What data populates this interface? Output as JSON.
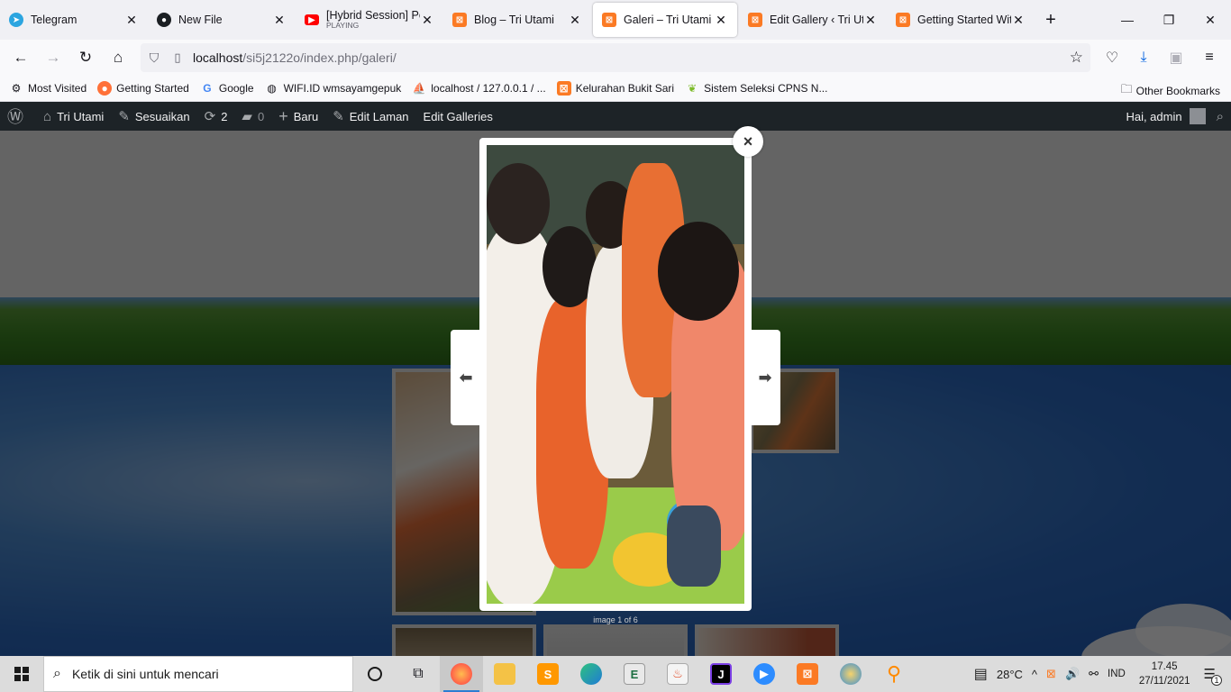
{
  "browser": {
    "tabs": [
      {
        "label": "Telegram",
        "icon": "telegram-icon",
        "sub": ""
      },
      {
        "label": "New File",
        "icon": "github-icon",
        "sub": ""
      },
      {
        "label": "[Hybrid Session] Per",
        "icon": "youtube-icon",
        "sub": "PLAYING"
      },
      {
        "label": "Blog – Tri Utami",
        "icon": "xampp-icon",
        "sub": ""
      },
      {
        "label": "Galeri – Tri Utami",
        "icon": "xampp-icon",
        "sub": ""
      },
      {
        "label": "Edit Gallery ‹ Tri Utar",
        "icon": "xampp-icon",
        "sub": ""
      },
      {
        "label": "Getting Started With",
        "icon": "xampp-icon",
        "sub": ""
      }
    ],
    "active_tab": 4,
    "url_host": "localhost",
    "url_path": "/si5j2122o/index.php/galeri/",
    "bookmarks": [
      {
        "label": "Most Visited",
        "icon": "gear-icon"
      },
      {
        "label": "Getting Started",
        "icon": "firefox-icon"
      },
      {
        "label": "Google",
        "icon": "google-icon"
      },
      {
        "label": "WIFI.ID wmsayamgepuk",
        "icon": "globe-icon"
      },
      {
        "label": "localhost / 127.0.0.1 / ...",
        "icon": "phpmyadmin-icon"
      },
      {
        "label": "Kelurahan Bukit Sari",
        "icon": "xampp-icon"
      },
      {
        "label": "Sistem Seleksi CPNS N...",
        "icon": "leaf-icon"
      }
    ],
    "other_bookmarks": "Other Bookmarks"
  },
  "wp_admin_bar": {
    "site_name": "Tri Utami",
    "customize": "Sesuaikan",
    "updates_count": "2",
    "comments_count": "0",
    "new_label": "Baru",
    "edit_page": "Edit Laman",
    "edit_galleries": "Edit Galleries",
    "greeting": "Hai, admin"
  },
  "lightbox": {
    "close_symbol": "×",
    "prev_symbol": "🡐",
    "next_symbol": "🡒",
    "counter": "image 1 of 6"
  },
  "taskbar": {
    "search_placeholder": "Ketik di sini untuk mencari",
    "weather": "28°C",
    "language": "IND",
    "time": "17.45",
    "date": "27/11/2021",
    "notification_count": "1"
  },
  "colors": {
    "wp_admin_bar": "#1d2327",
    "xampp_orange": "#fb7a24",
    "taskbar": "#dcdcdc",
    "sky_blue": "#2d6bc2"
  }
}
